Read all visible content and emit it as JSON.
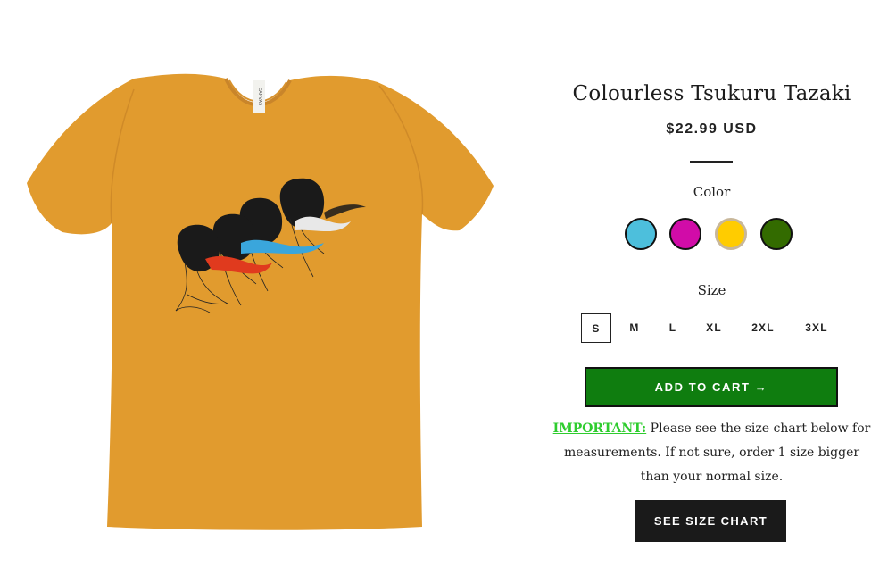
{
  "product": {
    "title": "Colourless Tsukuru Tazaki",
    "price": "$22.99 USD",
    "color_label": "Color",
    "colors": [
      {
        "name": "blue",
        "hex": "#4dbfdc"
      },
      {
        "name": "magenta",
        "hex": "#d10ca8"
      },
      {
        "name": "yellow",
        "hex": "#ffcc00",
        "selected": true
      },
      {
        "name": "green",
        "hex": "#336b00"
      }
    ],
    "size_label": "Size",
    "sizes": [
      "S",
      "M",
      "L",
      "XL",
      "2XL",
      "3XL"
    ],
    "selected_size": "S",
    "add_to_cart": "ADD TO CART →",
    "notice_important": "IMPORTANT:",
    "notice_text": " Please see the size chart below for measurements. If not sure, order 1 size bigger than your normal size.",
    "size_chart_button": "SEE SIZE CHART",
    "image": {
      "shirt_color": "#e19b2e",
      "tag_text": "CANVAS",
      "figure_colors": [
        "#e8e8e8",
        "#3aa6dc",
        "#e03a1e",
        "#1a1a1a"
      ]
    }
  }
}
